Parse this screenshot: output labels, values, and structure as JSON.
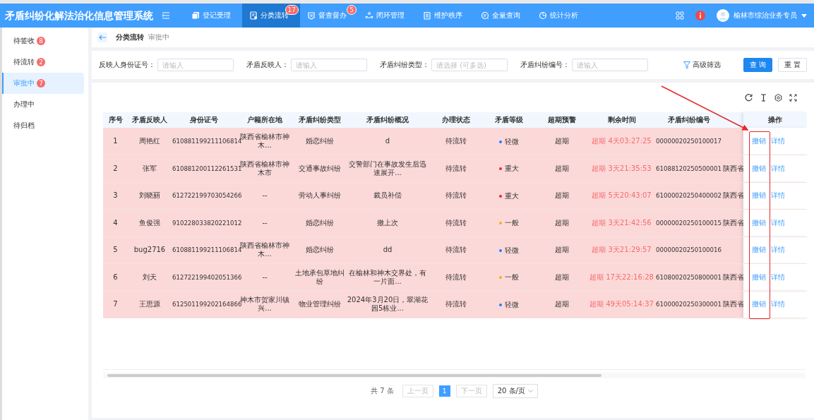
{
  "header": {
    "title": "矛盾纠纷化解法治化信息管理系统",
    "nav": [
      {
        "label": "登记受理",
        "selected": false
      },
      {
        "label": "分类流转",
        "selected": true,
        "badge": "17"
      },
      {
        "label": "督查督办",
        "selected": false,
        "badge": "5"
      },
      {
        "label": "闭环管理",
        "selected": false
      },
      {
        "label": "维护秩序",
        "selected": false
      },
      {
        "label": "全量查询",
        "selected": false
      },
      {
        "label": "统计分析",
        "selected": false
      }
    ],
    "user": "榆林市综治业务专员"
  },
  "sidebar": {
    "items": [
      {
        "label": "待签收",
        "badge": "8",
        "selected": false
      },
      {
        "label": "待流转",
        "badge": "2",
        "selected": false
      },
      {
        "label": "审批中",
        "badge": "7",
        "selected": true
      },
      {
        "label": "办理中",
        "selected": false
      },
      {
        "label": "待归档",
        "selected": false
      }
    ]
  },
  "breadcrumb": {
    "section": "分类流转",
    "current": "审批中"
  },
  "filters": {
    "fields": [
      {
        "label": "反映人身份证号：",
        "placeholder": "请输入"
      },
      {
        "label": "矛盾反映人：",
        "placeholder": "请输入"
      },
      {
        "label": "矛盾纠纷类型：",
        "placeholder": "请选择 (可多选)"
      },
      {
        "label": "矛盾纠纷编号：",
        "placeholder": "请输入"
      }
    ],
    "advanced": "高级筛选",
    "search": "查 询",
    "reset": "重 置"
  },
  "table": {
    "columns": [
      "序号",
      "矛盾反映人",
      "身份证号",
      "户籍所在地",
      "矛盾纠纷类型",
      "矛盾纠纷概况",
      "办理状态",
      "矛盾等级",
      "超期预警",
      "剩余时间",
      "矛盾纠纷编号",
      "操作"
    ],
    "rows": [
      {
        "index": "1",
        "name": "周艳红",
        "id_number": "610881199211106814",
        "residence": "陕西省榆林市神木...",
        "type": "婚恋纠纷",
        "summary": "d",
        "status": "待流转",
        "level": {
          "label": "轻微",
          "color": "#1e80ff"
        },
        "warning": "超期",
        "remaining": "超期 4天03:27:25",
        "number": "00000020250100017",
        "highlighted": true,
        "actions": [
          "撤销",
          "详情"
        ]
      },
      {
        "index": "2",
        "name": "张军",
        "id_number": "610881200112261531",
        "residence": "陕西省榆林市神木市",
        "type": "交通事故纠纷",
        "summary": "交警部门在事故发生后迅速展开...",
        "status": "待流转",
        "level": {
          "label": "重大",
          "color": "#f5222d"
        },
        "warning": "超期",
        "remaining": "超期 3天21:35:53",
        "number": "61088120250500001",
        "column_12": "陕西省",
        "highlighted": true,
        "actions": [
          "撤销",
          "详情"
        ]
      },
      {
        "index": "3",
        "name": "刘晓丽",
        "id_number": "612722199703054266",
        "residence": "--",
        "type": "劳动人事纠纷",
        "summary": "裁员补偿",
        "status": "待流转",
        "level": {
          "label": "重大",
          "color": "#f5222d"
        },
        "warning": "超期",
        "remaining": "超期 5天20:43:07",
        "number": "61000020250400002",
        "column_12": "陕西省",
        "highlighted": true,
        "actions": [
          "撤销",
          "详情"
        ]
      },
      {
        "index": "4",
        "name": "鱼俊强",
        "id_number": "910228033820221012",
        "residence": "--",
        "type": "婚恋纠纷",
        "summary": "撤上次",
        "status": "待流转",
        "level": {
          "label": "一般",
          "color": "#faad14"
        },
        "warning": "超期",
        "remaining": "超期 3天21:42:56",
        "number": "00000020250100015",
        "column_12": "陕西省",
        "highlighted": true,
        "actions": [
          "撤销",
          "详情"
        ]
      },
      {
        "index": "5",
        "name": "bug2716",
        "id_number": "610881199211106814",
        "residence": "陕西省榆林市神木...",
        "type": "婚恋纠纷",
        "summary": "dd",
        "status": "待流转",
        "level": {
          "label": "轻微",
          "color": "#1e80ff"
        },
        "warning": "超期",
        "remaining": "超期 3天21:29:57",
        "number": "00000020250100016",
        "highlighted": true,
        "actions": [
          "撤销",
          "详情"
        ]
      },
      {
        "index": "6",
        "name": "刘天",
        "id_number": "612722199402051366",
        "residence": "--",
        "type": "土地承包草地纠纷",
        "summary": "在榆林和神木交界处，有一片面...",
        "status": "待流转",
        "level": {
          "label": "一般",
          "color": "#faad14"
        },
        "warning": "超期",
        "remaining": "超期 17天22:16:28",
        "number": "61080020250800001",
        "column_12": "陕西省",
        "highlighted": true,
        "actions": [
          "撤销",
          "详情"
        ]
      },
      {
        "index": "7",
        "name": "王思源",
        "id_number": "612501199202164866",
        "residence": "神木市贺家川镇兴...",
        "type": "物业管理纠纷",
        "summary": "2024年3月20日，翠湖花园5栋业...",
        "status": "待流转",
        "level": {
          "label": "轻微",
          "color": "#1e80ff"
        },
        "warning": "超期",
        "remaining": "超期 49天05:14:37",
        "number": "61000020250300001",
        "column_12": "陕西省",
        "highlighted": true,
        "actions": [
          "撤销",
          "详情"
        ]
      }
    ]
  },
  "pagination": {
    "total": "共 7 条",
    "prev": "上一页",
    "pages": [
      {
        "label": "1",
        "selected": true
      }
    ],
    "next": "下一页",
    "page_size": "20 条/页"
  }
}
